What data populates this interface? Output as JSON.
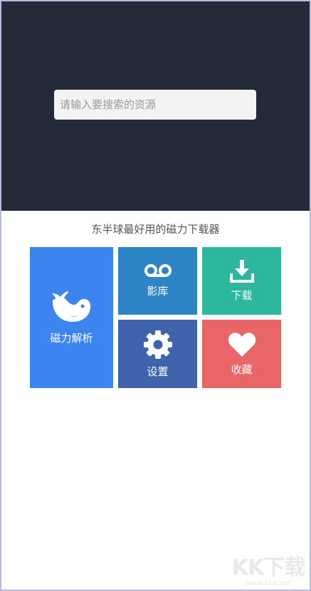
{
  "search": {
    "placeholder": "请输入要搜索的资源"
  },
  "slogan": "东半球最好用的磁力下载器",
  "tiles": {
    "magnet": {
      "label": "磁力解析",
      "icon": "whale-icon",
      "color": "#3c85f0"
    },
    "library": {
      "label": "影库",
      "icon": "cassette-icon",
      "color": "#2d85c5"
    },
    "download": {
      "label": "下载",
      "icon": "download-icon",
      "color": "#2db79e"
    },
    "settings": {
      "label": "设置",
      "icon": "gear-icon",
      "color": "#3f64ac"
    },
    "favorites": {
      "label": "收藏",
      "icon": "heart-icon",
      "color": "#e86668"
    }
  },
  "watermark": {
    "main": "KK下载",
    "url": "www.kkx.net"
  }
}
